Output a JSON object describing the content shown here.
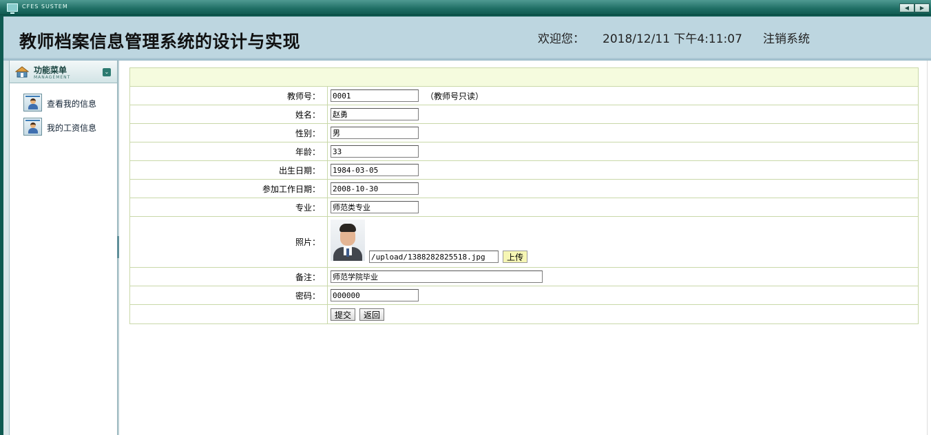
{
  "system": {
    "title": "CFES SUSTEM",
    "nav_prev": "◀",
    "nav_next": "▶"
  },
  "header": {
    "app_title": "教师档案信息管理系统的设计与实现",
    "welcome": "欢迎您：",
    "datetime": "2018/12/11 下午4:11:07",
    "logout": "注销系统"
  },
  "sidebar": {
    "menu_title": "功能菜单",
    "menu_subtitle": "MANAGEMENT",
    "items": [
      {
        "label": "查看我的信息",
        "icon": "user-icon"
      },
      {
        "label": "我的工资信息",
        "icon": "user-icon"
      }
    ]
  },
  "form": {
    "teacher_id": {
      "label": "教师号：",
      "value": "0001",
      "note": "（教师号只读）"
    },
    "name": {
      "label": "姓名：",
      "value": "赵勇"
    },
    "gender": {
      "label": "性别：",
      "value": "男"
    },
    "age": {
      "label": "年龄：",
      "value": "33"
    },
    "birth_date": {
      "label": "出生日期：",
      "value": "1984-03-05"
    },
    "work_date": {
      "label": "参加工作日期：",
      "value": "2008-10-30"
    },
    "major": {
      "label": "专业：",
      "value": "师范类专业"
    },
    "photo": {
      "label": "照片：",
      "path": "/upload/1388282825518.jpg",
      "upload_label": "上传"
    },
    "remark": {
      "label": "备注：",
      "value": "师范学院毕业"
    },
    "password": {
      "label": "密码：",
      "value": "000000"
    },
    "submit_label": "提交",
    "back_label": "返回"
  }
}
